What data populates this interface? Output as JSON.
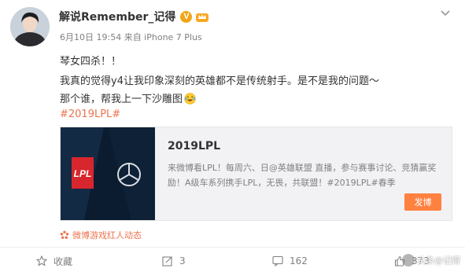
{
  "post": {
    "author": "解说Remember_记得",
    "verified_badge": "V",
    "meta": "6月10日 19:54 来自 iPhone 7 Plus",
    "lines": [
      "琴女四杀！！",
      "我真的觉得y4让我印象深刻的英雄都不是传统射手。是不是我的问题～",
      "那个谁，帮我上一下沙雕图"
    ],
    "hashtag": "#2019LPL#"
  },
  "card": {
    "title": "2019LPL",
    "description": "来微博看LPL！每周六、日@英雄联盟 直播，参与赛事讨论、竞猜赢奖励！A级车系列携手LPL，无畏，共联盟！#2019LPL#春季",
    "button": "发博",
    "logo_text": "LPL"
  },
  "source": "微博游戏红人动态",
  "actions": {
    "favorite": "收藏",
    "repost": "3",
    "comment": "162",
    "like": "373"
  },
  "watermark": "头条@记得",
  "colors": {
    "accent": "#eb7350",
    "button": "#ff8140",
    "badge": "#f2a516",
    "lpl_red": "#d7262e"
  }
}
